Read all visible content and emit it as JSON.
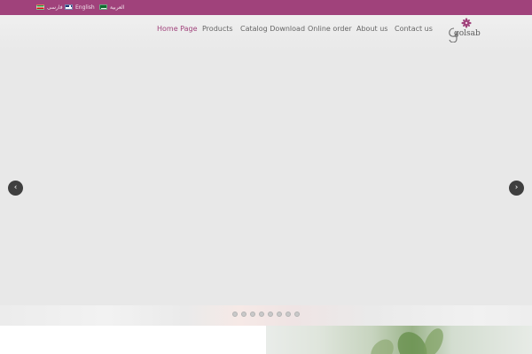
{
  "topbar": {
    "languages": [
      {
        "label": "فارسی",
        "flag": "iran-flag-icon"
      },
      {
        "label": "English",
        "flag": "uk-flag-icon"
      },
      {
        "label": "العربية",
        "flag": "saudi-flag-icon"
      }
    ]
  },
  "nav": {
    "items": [
      {
        "label": "Home Page",
        "active": true
      },
      {
        "label": "Products",
        "active": false
      },
      {
        "label": "Catalog Download",
        "active": false
      },
      {
        "label": "Online order",
        "active": false
      },
      {
        "label": "About us",
        "active": false
      },
      {
        "label": "Contact us",
        "active": false
      }
    ]
  },
  "logo": {
    "text": "golsab"
  },
  "slider": {
    "prev_icon": "‹",
    "next_icon": "›",
    "slide_count": 8,
    "active_slide": 0
  },
  "colors": {
    "brand": "#a0427b",
    "nav_text": "#666666",
    "slider_bg": "#e8e8e8",
    "arrow_bg": "#3f3f3f"
  }
}
